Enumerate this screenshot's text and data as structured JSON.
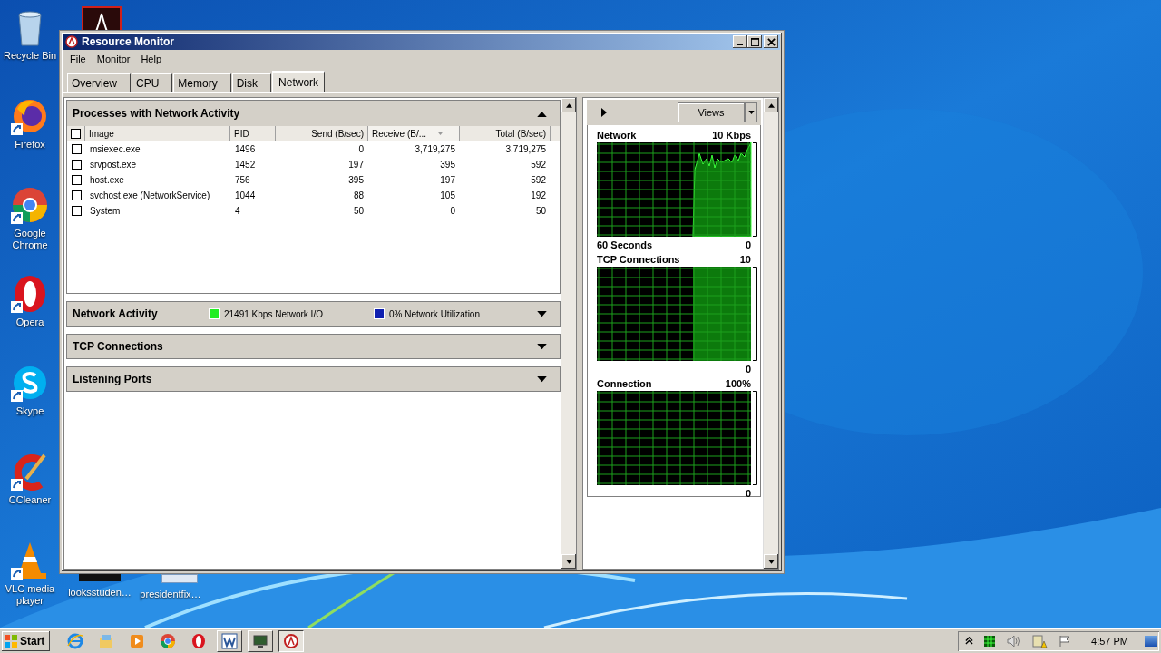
{
  "desktop_icons": [
    {
      "label": "Recycle Bin",
      "kind": "recycle"
    },
    {
      "label": "Firefox",
      "kind": "firefox"
    },
    {
      "label": "Google Chrome",
      "kind": "chrome"
    },
    {
      "label": "Opera",
      "kind": "opera"
    },
    {
      "label": "Skype",
      "kind": "skype"
    },
    {
      "label": "CCleaner",
      "kind": "ccleaner"
    },
    {
      "label": "VLC media player",
      "kind": "vlc"
    }
  ],
  "desktop_files": [
    {
      "label": "looksstuden…",
      "kind": "dark"
    },
    {
      "label": "presidentfix…",
      "kind": "light"
    }
  ],
  "window": {
    "title": "Resource Monitor",
    "menu": [
      "File",
      "Monitor",
      "Help"
    ],
    "tabs": [
      {
        "label": "Overview",
        "selected": false
      },
      {
        "label": "CPU",
        "selected": false
      },
      {
        "label": "Memory",
        "selected": false
      },
      {
        "label": "Disk",
        "selected": false
      },
      {
        "label": "Network",
        "selected": true
      }
    ],
    "processes": {
      "title": "Processes with Network Activity",
      "expanded": true,
      "all_checked": false,
      "columns": [
        {
          "label": "Image",
          "sorted": false
        },
        {
          "label": "PID",
          "sorted": false
        },
        {
          "label": "Send (B/sec)",
          "sorted": false
        },
        {
          "label": "Receive (B/...",
          "sorted": true
        },
        {
          "label": "Total (B/sec)",
          "sorted": false
        }
      ],
      "rows": [
        {
          "checked": false,
          "cells": [
            "msiexec.exe",
            "1496",
            "0",
            "3,719,275",
            "3,719,275"
          ]
        },
        {
          "checked": false,
          "cells": [
            "srvpost.exe",
            "1452",
            "197",
            "395",
            "592"
          ]
        },
        {
          "checked": false,
          "cells": [
            "host.exe",
            "756",
            "395",
            "197",
            "592"
          ]
        },
        {
          "checked": false,
          "cells": [
            "svchost.exe (NetworkService)",
            "1044",
            "88",
            "105",
            "192"
          ]
        },
        {
          "checked": false,
          "cells": [
            "System",
            "4",
            "50",
            "0",
            "50"
          ]
        }
      ]
    },
    "sections": [
      {
        "title": "Network Activity",
        "expanded": false,
        "legend": [
          {
            "text": "21491 Kbps Network I/O",
            "color": "#22ee22"
          },
          {
            "text": "0% Network Utilization",
            "color": "#1020b0"
          }
        ]
      },
      {
        "title": "TCP Connections",
        "expanded": false
      },
      {
        "title": "Listening Ports",
        "expanded": false
      }
    ],
    "views_button": "Views",
    "graphs": [
      {
        "title": "Network",
        "max": "10 Kbps",
        "span": "60 Seconds",
        "min": "0",
        "kind": "wave"
      },
      {
        "title": "TCP Connections",
        "max": "10",
        "min": "0",
        "kind": "block"
      },
      {
        "title": "Connection",
        "max": "100%",
        "min": "0",
        "kind": "empty"
      }
    ]
  },
  "taskbar": {
    "start": "Start",
    "apps": [
      {
        "kind": "ie",
        "open": false,
        "selected": false
      },
      {
        "kind": "folder",
        "open": false,
        "selected": false
      },
      {
        "kind": "media",
        "open": false,
        "selected": false
      },
      {
        "kind": "chrome",
        "open": false,
        "selected": false
      },
      {
        "kind": "opera",
        "open": false,
        "selected": false
      },
      {
        "kind": "word",
        "open": true,
        "selected": false
      },
      {
        "kind": "monitor",
        "open": true,
        "selected": false
      },
      {
        "kind": "resmon",
        "open": true,
        "selected": true
      }
    ],
    "time": "4:57 PM"
  }
}
